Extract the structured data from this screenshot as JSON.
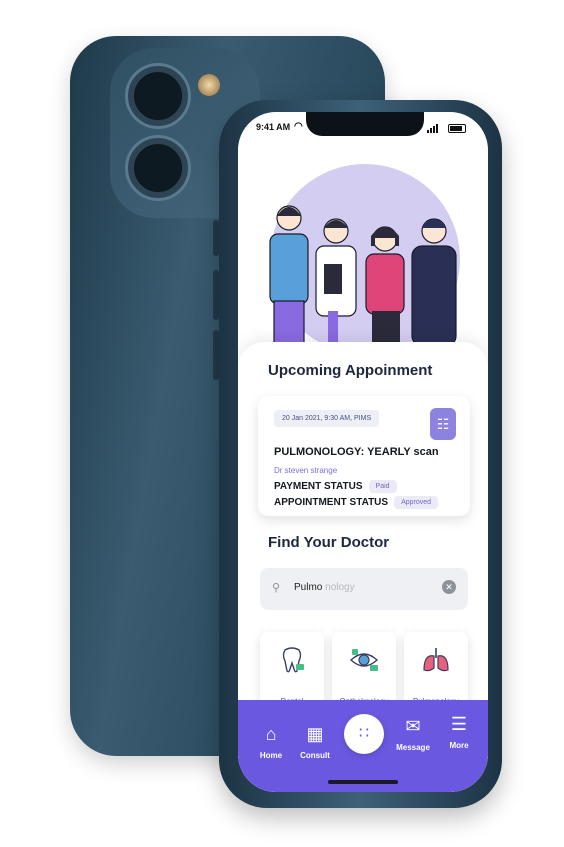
{
  "status": {
    "time": "9:41 AM"
  },
  "upcoming": {
    "title": "Upcoming Appoinment",
    "date": "20 Jan 2021, 9:30 AM, PIMS",
    "specialty": "PULMONOLOGY: YEARLY scan",
    "doctor": "Dr steven strange",
    "payment_label": "PAYMENT STATUS",
    "payment_badge": "Paid",
    "appointment_label": "APPOINTMENT STATUS",
    "appointment_badge": "Approved"
  },
  "find": {
    "title": "Find Your Doctor",
    "search_value": "Pulmo",
    "search_ghost": "nology"
  },
  "specialties": [
    {
      "label": "Dental"
    },
    {
      "label": "Opthalmology"
    },
    {
      "label": "Pulmonology"
    }
  ],
  "nav": {
    "home": "Home",
    "consult": "Consult",
    "message": "Message",
    "more": "More"
  },
  "colors": {
    "accent": "#6a58e0",
    "blob": "#d4cdf2"
  }
}
